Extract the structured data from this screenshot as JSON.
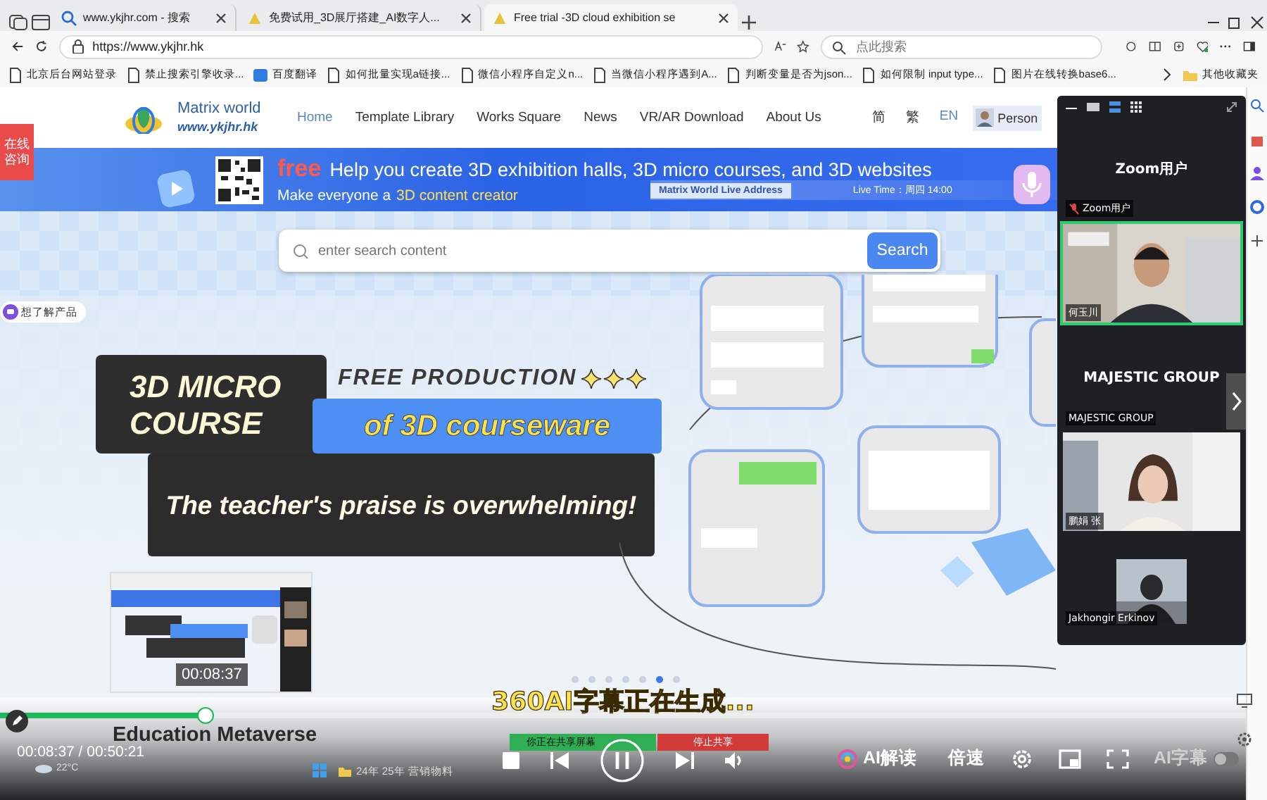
{
  "browser": {
    "tabs": [
      {
        "label": "www.ykjhr.com - 搜索",
        "selected": false
      },
      {
        "label": "免费试用_3D展厅搭建_AI数字人...",
        "selected": false
      },
      {
        "label": "Free trial -3D cloud exhibition se",
        "selected": true
      }
    ],
    "address": "https://www.ykjhr.hk",
    "search_placeholder": "点此搜索",
    "bookmarks": [
      "北京后台网站登录",
      "禁止搜索引擎收录...",
      "百度翻译",
      "如何批量实现a链接...",
      "微信小程序自定义n...",
      "当微信小程序遇到A...",
      "判断变量是否为json...",
      "如何限制 input type...",
      "图片在线转换base6..."
    ],
    "other_bookmarks": "其他收藏夹"
  },
  "site": {
    "logo_name": "Matrix world",
    "logo_url": "www.ykjhr.hk",
    "nav": [
      {
        "label": "Home",
        "selected": true
      },
      {
        "label": "Template Library",
        "selected": false
      },
      {
        "label": "Works Square",
        "selected": false
      },
      {
        "label": "News",
        "selected": false
      },
      {
        "label": "VR/AR Download",
        "selected": false
      },
      {
        "label": "About Us",
        "selected": false
      }
    ],
    "languages": [
      {
        "label": "简",
        "selected": false
      },
      {
        "label": "繁",
        "selected": false
      },
      {
        "label": "EN",
        "selected": true
      }
    ],
    "account": "Person",
    "consult": "在线咨询",
    "product_chip": "想了解产品",
    "banner": {
      "free": "free",
      "headline": "Help you create 3D exhibition halls, 3D micro courses, and 3D websites",
      "sub_before": "Make everyone a",
      "sub_highlight": "3D content creator",
      "live_address": "Matrix World Live Address",
      "live_time": "Live Time：周四 14:00"
    },
    "search": {
      "placeholder": "enter search content",
      "button": "Search"
    },
    "hero": {
      "title": "3D MICRO COURSE",
      "free_production": "FREE PRODUCTION",
      "courseware": "of 3D courseware",
      "praise": "The teacher's praise is overwhelming!"
    },
    "carousel_dots": [
      {
        "selected": false
      },
      {
        "selected": false
      },
      {
        "selected": false
      },
      {
        "selected": false
      },
      {
        "selected": false
      },
      {
        "selected": true
      },
      {
        "selected": false
      }
    ]
  },
  "meeting": {
    "tiles": [
      {
        "kind": "name",
        "title": "Zoom用户",
        "name": "Zoom用户",
        "muted": true,
        "speaking": false
      },
      {
        "kind": "video",
        "name": "何玉川",
        "muted": false,
        "speaking": true
      },
      {
        "kind": "name",
        "title": "MAJESTIC GROUP",
        "name": "MAJESTIC GROUP",
        "muted": false,
        "speaking": false
      },
      {
        "kind": "video",
        "name": "鹏娟 张",
        "muted": false,
        "speaking": false
      },
      {
        "kind": "small_video",
        "name": "Jakhongir Erkinov",
        "muted": false,
        "speaking": false
      }
    ]
  },
  "recording": {
    "weather": "22°C",
    "folder": "24年  25年 营销物料",
    "sharing": "你正在共享屏幕",
    "stop_sharing": "停止共享"
  },
  "player": {
    "subtitle": "360AI字幕正在生成...",
    "title": "Education Metaverse",
    "time": "00:08:37 / 00:50:21",
    "level": 0.165,
    "preview_time": "00:08:37",
    "ai_read": "AI解读",
    "speed": "倍速",
    "ai_caption": "AI字幕",
    "ai_caption_on": false,
    "playing": true
  }
}
